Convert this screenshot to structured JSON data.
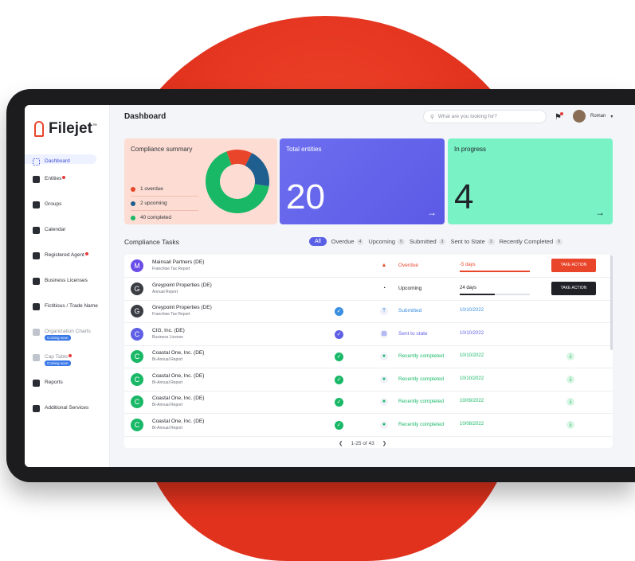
{
  "app": {
    "name": "Filejet",
    "trademark": "™"
  },
  "sidebar": {
    "items": [
      {
        "label": "Dashboard",
        "icon": "grid-icon",
        "active": true
      },
      {
        "label": "Entities",
        "icon": "entity-icon",
        "badge_dot": true
      },
      {
        "label": "Groups",
        "icon": "groups-icon"
      },
      {
        "label": "Calendar",
        "icon": "calendar-icon"
      },
      {
        "label": "Registered Agent",
        "icon": "agent-icon",
        "badge_dot": true
      },
      {
        "label": "Business Licenses",
        "icon": "license-icon"
      },
      {
        "label": "Fictitious / Trade Name",
        "icon": "trade-name-icon"
      },
      {
        "label": "Organization Charts",
        "icon": "org-chart-icon",
        "tag": "Coming soon"
      },
      {
        "label": "Cap Table",
        "icon": "cap-table-icon",
        "badge_dot": true,
        "tag": "Coming soon"
      },
      {
        "label": "Reports",
        "icon": "reports-icon"
      },
      {
        "label": "Additional Services",
        "icon": "services-icon"
      }
    ]
  },
  "header": {
    "title": "Dashboard",
    "search_placeholder": "What are you looking for?",
    "user_name": "Roman"
  },
  "summary": {
    "title": "Compliance summary",
    "items": [
      {
        "label": "1 overdue",
        "value": 1,
        "color": "#e8452b"
      },
      {
        "label": "2 upcoming",
        "value": 2,
        "color": "#1f5f8f"
      },
      {
        "label": "40 completed",
        "value": 40,
        "color": "#19b867"
      }
    ]
  },
  "cards": {
    "total": {
      "title": "Total entities",
      "value": "20"
    },
    "progress": {
      "title": "In progress",
      "value": "4"
    }
  },
  "tasks": {
    "title": "Compliance Tasks",
    "filters": [
      {
        "label": "All",
        "count": ""
      },
      {
        "label": "Overdue",
        "count": "4"
      },
      {
        "label": "Upcoming",
        "count": "5"
      },
      {
        "label": "Submitted",
        "count": "3"
      },
      {
        "label": "Sent to State",
        "count": "3"
      },
      {
        "label": "Recently Completed",
        "count": "9"
      }
    ],
    "rows": [
      {
        "initial": "M",
        "av_color": "#6a4de8",
        "name": "Mainsail Partners (DE)",
        "sub": "Franchise Tax Report",
        "status": "Overdue",
        "status_color": "#e8452b",
        "status_icon": "warning-icon",
        "date": "-5 days",
        "date_color": "#e8452b",
        "progress": 1.0,
        "bar_color": "#e8452b",
        "action": "TAKE ACTION",
        "action_color": "#e8452b"
      },
      {
        "initial": "G",
        "av_color": "#3a3d44",
        "name": "Greypoint Properties (DE)",
        "sub": "Annual Report",
        "status": "Upcoming",
        "status_color": "#23252b",
        "status_icon": "clock-icon",
        "date": "24 days",
        "date_color": "#23252b",
        "progress": 0.5,
        "bar_color": "#23252b",
        "action": "TAKE ACTION",
        "action_color": "#1f2126"
      },
      {
        "initial": "G",
        "av_color": "#3a3d44",
        "name": "Greypoint Properties (DE)",
        "sub": "Franchise Tax Report",
        "check_color": "#3a8fe0",
        "status": "Submitted",
        "status_color": "#3a8fe0",
        "status_icon": "upload-icon",
        "date": "10/10/2022",
        "date_color": "#3a8fe0"
      },
      {
        "initial": "C",
        "av_color": "#5f5fe6",
        "name": "CIG, Inc. (DE)",
        "sub": "Business License",
        "check_color": "#5f5fe6",
        "status": "Sent to state",
        "status_color": "#5f5fe6",
        "status_icon": "sent-icon",
        "date": "10/10/2022",
        "date_color": "#5f5fe6"
      },
      {
        "initial": "C",
        "av_color": "#19b867",
        "name": "Coastal One, Inc. (DE)",
        "sub": "Bi-Annual Report",
        "check_color": "#19b867",
        "status": "Recently completed",
        "status_color": "#19b867",
        "status_icon": "dot-icon",
        "date": "10/10/2022",
        "date_color": "#19b867",
        "download": true
      },
      {
        "initial": "C",
        "av_color": "#19b867",
        "name": "Coastal One, Inc. (DE)",
        "sub": "Bi-Annual Report",
        "check_color": "#19b867",
        "status": "Recently completed",
        "status_color": "#19b867",
        "status_icon": "dot-icon",
        "date": "10/10/2022",
        "date_color": "#19b867",
        "download": true
      },
      {
        "initial": "C",
        "av_color": "#19b867",
        "name": "Coastal One, Inc. (DE)",
        "sub": "Bi-Annual Report",
        "check_color": "#19b867",
        "status": "Recently completed",
        "status_color": "#19b867",
        "status_icon": "dot-icon",
        "date": "10/09/2022",
        "date_color": "#19b867",
        "download": true
      },
      {
        "initial": "C",
        "av_color": "#19b867",
        "name": "Coastal One, Inc. (DE)",
        "sub": "Bi-Annual Report",
        "check_color": "#19b867",
        "status": "Recently completed",
        "status_color": "#19b867",
        "status_icon": "dot-icon",
        "date": "10/08/2022",
        "date_color": "#19b867",
        "download": true
      }
    ],
    "pagination": "1-25 of 43"
  }
}
